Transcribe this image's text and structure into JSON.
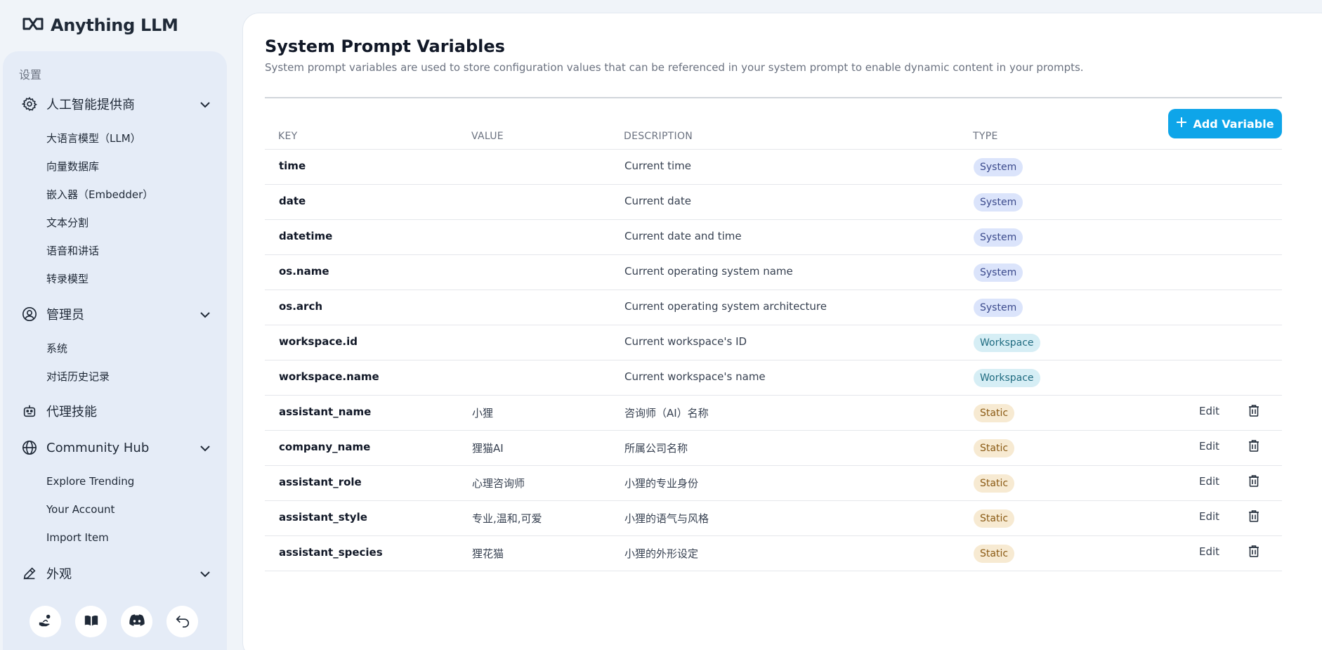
{
  "app": {
    "brand_name": "Anything LLM",
    "logo_icon": "anything-llm-logo-icon"
  },
  "sidebar": {
    "section_label": "设置",
    "groups": [
      {
        "label": "人工智能提供商",
        "icon": "gear-icon",
        "expanded": true,
        "items": [
          "大语言模型（LLM）",
          "向量数据库",
          "嵌入器（Embedder）",
          "文本分割",
          "语音和讲话",
          "转录模型"
        ]
      },
      {
        "label": "管理员",
        "icon": "user-admin-icon",
        "expanded": true,
        "items": [
          "系统",
          "对话历史记录"
        ]
      },
      {
        "label": "代理技能",
        "icon": "robot-icon",
        "expanded": false,
        "items": []
      },
      {
        "label": "Community Hub",
        "icon": "globe-icon",
        "expanded": true,
        "items": [
          "Explore Trending",
          "Your Account",
          "Import Item"
        ]
      },
      {
        "label": "外观",
        "icon": "pencil-icon",
        "expanded": true,
        "items": []
      }
    ],
    "footer_buttons": [
      "support-hand-icon",
      "book-icon",
      "discord-icon",
      "back-arrow-icon"
    ]
  },
  "main": {
    "title": "System Prompt Variables",
    "description": "System prompt variables are used to store configuration values that can be referenced in your system prompt to enable dynamic content in your prompts.",
    "add_button_label": "Add Variable",
    "columns": {
      "key": "KEY",
      "value": "VALUE",
      "description": "DESCRIPTION",
      "type": "TYPE"
    },
    "rows": [
      {
        "key": "time",
        "value": "",
        "description": "Current time",
        "type": "System",
        "editable": false
      },
      {
        "key": "date",
        "value": "",
        "description": "Current date",
        "type": "System",
        "editable": false
      },
      {
        "key": "datetime",
        "value": "",
        "description": "Current date and time",
        "type": "System",
        "editable": false
      },
      {
        "key": "os.name",
        "value": "",
        "description": "Current operating system name",
        "type": "System",
        "editable": false
      },
      {
        "key": "os.arch",
        "value": "",
        "description": "Current operating system architecture",
        "type": "System",
        "editable": false
      },
      {
        "key": "workspace.id",
        "value": "",
        "description": "Current workspace's ID",
        "type": "Workspace",
        "editable": false
      },
      {
        "key": "workspace.name",
        "value": "",
        "description": "Current workspace's name",
        "type": "Workspace",
        "editable": false
      },
      {
        "key": "assistant_name",
        "value": "小狸",
        "description": "咨询师（AI）名称",
        "type": "Static",
        "editable": true
      },
      {
        "key": "company_name",
        "value": "狸猫AI",
        "description": "所属公司名称",
        "type": "Static",
        "editable": true
      },
      {
        "key": "assistant_role",
        "value": "心理咨询师",
        "description": "小狸的专业身份",
        "type": "Static",
        "editable": true
      },
      {
        "key": "assistant_style",
        "value": "专业,温和,可爱",
        "description": "小狸的语气与风格",
        "type": "Static",
        "editable": true
      },
      {
        "key": "assistant_species",
        "value": "狸花猫",
        "description": "小狸的外形设定",
        "type": "Static",
        "editable": true
      }
    ],
    "edit_label": "Edit"
  },
  "colors": {
    "accent": "#0ea5e9",
    "sidebar_bg": "#e5ecf7",
    "badge_system": "#dbe4fb",
    "badge_workspace": "#d6eef5",
    "badge_static": "#f7ead2"
  }
}
